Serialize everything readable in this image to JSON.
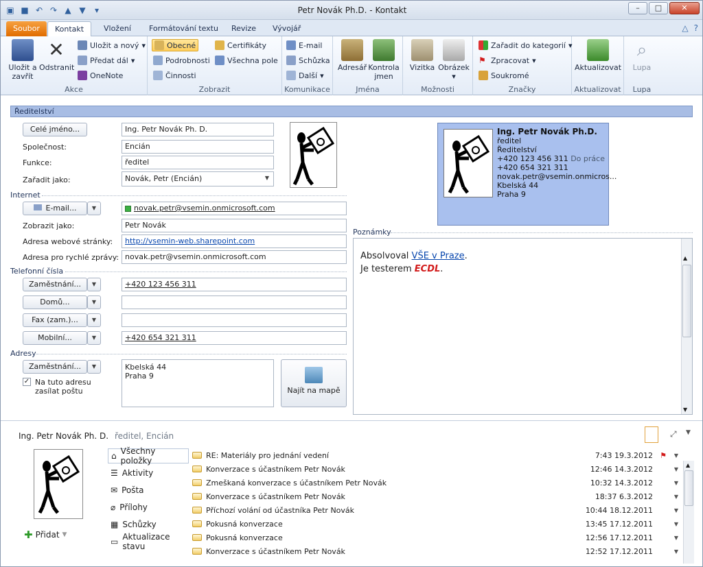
{
  "window": {
    "title": "Petr Novák Ph.D.  -  Kontakt"
  },
  "tabs": [
    "Soubor",
    "Kontakt",
    "Vložení",
    "Formátování textu",
    "Revize",
    "Vývojář"
  ],
  "ribbon": {
    "akce": {
      "label": "Akce",
      "save_close": "Uložit a zavřít",
      "delete": "Odstranit",
      "save_as_new": "Uložit a nový",
      "forward": "Předat dál",
      "onenote": "OneNote"
    },
    "zobrazit": {
      "label": "Zobrazit",
      "general": "Obecné",
      "details": "Podrobnosti",
      "activities": "Činnosti",
      "certificates": "Certifikáty",
      "all_fields": "Všechna pole"
    },
    "komunikace": {
      "label": "Komunikace",
      "email": "E-mail",
      "meeting": "Schůzka",
      "more": "Další"
    },
    "jmena": {
      "label": "Jména",
      "address_book": "Adresář",
      "check_names": "Kontrola jmen"
    },
    "moznosti": {
      "label": "Možnosti",
      "card": "Vizitka",
      "picture": "Obrázek"
    },
    "znacky": {
      "label": "Značky",
      "categorize": "Zařadit do kategorií",
      "followup": "Zpracovat",
      "private": "Soukromé"
    },
    "aktualizovat": {
      "label": "Aktualizovat",
      "update": "Aktualizovat"
    },
    "lupa": {
      "label": "Lupa",
      "zoom": "Lupa"
    }
  },
  "form": {
    "section": "Ředitelství",
    "full_name_btn": "Celé jméno...",
    "full_name": "Ing. Petr Novák Ph. D.",
    "company_label": "Společnost:",
    "company": "Encián",
    "job_label": "Funkce:",
    "job": "ředitel",
    "file_as_label": "Zařadit jako:",
    "file_as": "Novák, Petr (Encián)",
    "internet_header": "Internet",
    "email_btn": "E-mail...",
    "email": "novak.petr@vsemin.onmicrosoft.com",
    "display_as_label": "Zobrazit jako:",
    "display_as": "Petr Novák",
    "web_label": "Adresa webové stránky:",
    "web": "http://vsemin-web.sharepoint.com",
    "im_label": "Adresa pro rychlé zprávy:",
    "im": "novak.petr@vsemin.onmicrosoft.com",
    "phones_header": "Telefonní čísla",
    "phone_work_btn": "Zaměstnání...",
    "phone_work": "+420 123 456 311",
    "phone_home_btn": "Domů...",
    "phone_home": "",
    "phone_fax_btn": "Fax (zam.)...",
    "phone_fax": "",
    "phone_mobile_btn": "Mobilní...",
    "phone_mobile": "+420 654 321 311",
    "addresses_header": "Adresy",
    "address_btn": "Zaměstnání...",
    "address_line1": "Kbelská 44",
    "address_line2": "Praha 9",
    "mailing_label": "Na tuto adresu zasílat poštu",
    "map_btn": "Najít na mapě",
    "notes_header": "Poznámky",
    "notes_prefix": "Absolvoval ",
    "notes_link": "VŠE v Praze",
    "notes_suffix": ".",
    "notes_line2_prefix": "Je testerem ",
    "notes_line2_em": "ECDL",
    "notes_line2_suffix": "."
  },
  "card": {
    "name": "Ing. Petr Novák Ph.D.",
    "title": "ředitel",
    "dept": "Ředitelství",
    "phone_work": "+420 123 456 311",
    "phone_work_tag": "Do práce",
    "phone_mobile": "+420 654 321 311",
    "email": "novak.petr@vsemin.onmicros...",
    "addr1": "Kbelská 44",
    "addr2": "Praha 9"
  },
  "people_pane": {
    "name": "Ing. Petr Novák Ph. D.",
    "subtitle": "ředitel, Encián",
    "add": "Přidat",
    "nav": [
      "Všechny položky",
      "Aktivity",
      "Pošta",
      "Přílohy",
      "Schůzky",
      "Aktualizace stavu"
    ],
    "items": [
      {
        "subject": "RE: Materiály pro jednání vedení",
        "time": "7:43",
        "date": "19.3.2012",
        "flag": true
      },
      {
        "subject": "Konverzace s účastníkem Petr Novák",
        "time": "12:46",
        "date": "14.3.2012",
        "flag": false
      },
      {
        "subject": "Zmeškaná konverzace s účastníkem Petr Novák",
        "time": "10:32",
        "date": "14.3.2012",
        "flag": false
      },
      {
        "subject": "Konverzace s účastníkem Petr Novák",
        "time": "18:37",
        "date": "6.3.2012",
        "flag": false
      },
      {
        "subject": "Příchozí volání od účastníka Petr Novák",
        "time": "10:44",
        "date": "18.12.2011",
        "flag": false
      },
      {
        "subject": "Pokusná konverzace",
        "time": "13:45",
        "date": "17.12.2011",
        "flag": false
      },
      {
        "subject": "Pokusná konverzace",
        "time": "12:56",
        "date": "17.12.2011",
        "flag": false
      },
      {
        "subject": "Konverzace s účastníkem Petr Novák",
        "time": "12:52",
        "date": "17.12.2011",
        "flag": false
      }
    ]
  }
}
